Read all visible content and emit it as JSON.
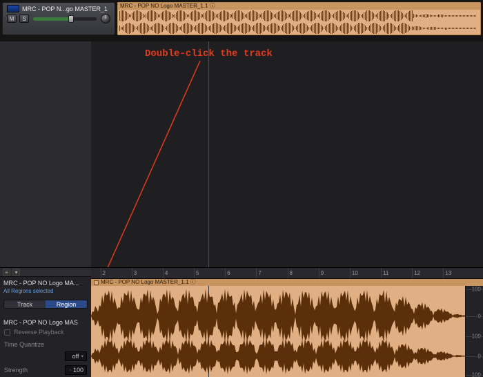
{
  "track": {
    "title": "MRC - POP N...go MASTER_1",
    "mute_label": "M",
    "solo_label": "S"
  },
  "top_region": {
    "label": "MRC - POP NO Logo MASTER_1.1  ⓘ"
  },
  "annotation": {
    "text": "Double-click the track"
  },
  "editor": {
    "filename": "MRC - POP NO Logo MA...",
    "subtitle": "All Regions selected",
    "seg_track": "Track",
    "seg_region": "Region",
    "region_name": "MRC - POP NO Logo MAS",
    "reverse_label": "Reverse Playback",
    "time_quantize_label": "Time Quantize",
    "tq_value": "off",
    "strength_label": "Strength",
    "strength_value": "100",
    "region_bar_label": "MRC - POP NO Logo MASTER_1.1  ⓘ",
    "ruler_nums": [
      "2",
      "3",
      "4",
      "5",
      "6",
      "7",
      "8",
      "9",
      "10",
      "11",
      "12",
      "13"
    ],
    "db_marks": [
      "-100",
      "0",
      "-100",
      "0",
      "-100"
    ]
  },
  "colors": {
    "waveform_fill": "#5a2f0a",
    "region_bg": "#e0b084"
  }
}
